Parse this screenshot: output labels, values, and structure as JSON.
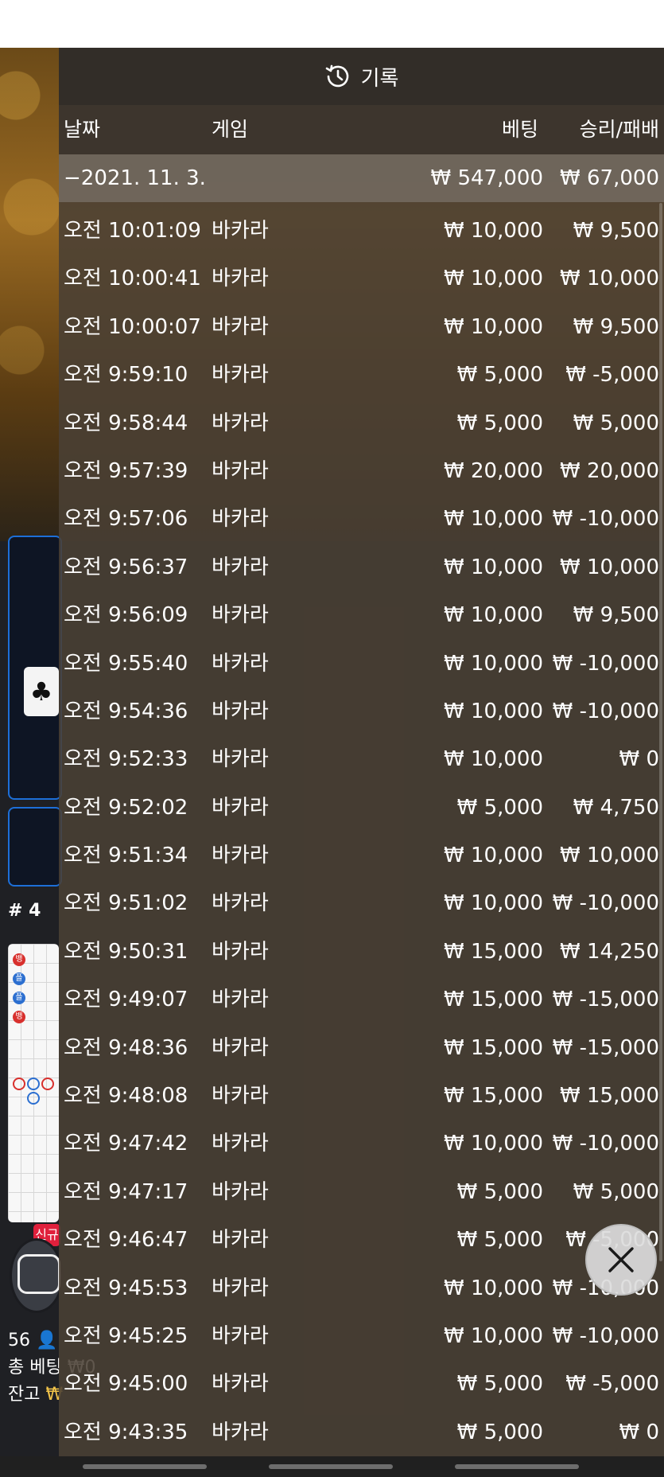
{
  "header": {
    "title": "기록",
    "icon": "history-icon"
  },
  "columns": {
    "date": "날짜",
    "game": "게임",
    "bet": "베팅",
    "winloss": "승리/패배"
  },
  "summary": {
    "date": "−2021. 11. 3.",
    "bet": "₩ 547,000",
    "winloss": "₩ 67,000"
  },
  "rows": [
    {
      "time": "오전 10:01:09",
      "game": "바카라",
      "bet": "₩ 10,000",
      "winloss": "₩ 9,500"
    },
    {
      "time": "오전 10:00:41",
      "game": "바카라",
      "bet": "₩ 10,000",
      "winloss": "₩ 10,000"
    },
    {
      "time": "오전 10:00:07",
      "game": "바카라",
      "bet": "₩ 10,000",
      "winloss": "₩ 9,500"
    },
    {
      "time": "오전 9:59:10",
      "game": "바카라",
      "bet": "₩ 5,000",
      "winloss": "₩ -5,000"
    },
    {
      "time": "오전 9:58:44",
      "game": "바카라",
      "bet": "₩ 5,000",
      "winloss": "₩ 5,000"
    },
    {
      "time": "오전 9:57:39",
      "game": "바카라",
      "bet": "₩ 20,000",
      "winloss": "₩ 20,000"
    },
    {
      "time": "오전 9:57:06",
      "game": "바카라",
      "bet": "₩ 10,000",
      "winloss": "₩ -10,000"
    },
    {
      "time": "오전 9:56:37",
      "game": "바카라",
      "bet": "₩ 10,000",
      "winloss": "₩ 10,000"
    },
    {
      "time": "오전 9:56:09",
      "game": "바카라",
      "bet": "₩ 10,000",
      "winloss": "₩ 9,500"
    },
    {
      "time": "오전 9:55:40",
      "game": "바카라",
      "bet": "₩ 10,000",
      "winloss": "₩ -10,000"
    },
    {
      "time": "오전 9:54:36",
      "game": "바카라",
      "bet": "₩ 10,000",
      "winloss": "₩ -10,000"
    },
    {
      "time": "오전 9:52:33",
      "game": "바카라",
      "bet": "₩ 10,000",
      "winloss": "₩ 0"
    },
    {
      "time": "오전 9:52:02",
      "game": "바카라",
      "bet": "₩ 5,000",
      "winloss": "₩ 4,750"
    },
    {
      "time": "오전 9:51:34",
      "game": "바카라",
      "bet": "₩ 10,000",
      "winloss": "₩ 10,000"
    },
    {
      "time": "오전 9:51:02",
      "game": "바카라",
      "bet": "₩ 10,000",
      "winloss": "₩ -10,000"
    },
    {
      "time": "오전 9:50:31",
      "game": "바카라",
      "bet": "₩ 15,000",
      "winloss": "₩ 14,250"
    },
    {
      "time": "오전 9:49:07",
      "game": "바카라",
      "bet": "₩ 15,000",
      "winloss": "₩ -15,000"
    },
    {
      "time": "오전 9:48:36",
      "game": "바카라",
      "bet": "₩ 15,000",
      "winloss": "₩ -15,000"
    },
    {
      "time": "오전 9:48:08",
      "game": "바카라",
      "bet": "₩ 15,000",
      "winloss": "₩ 15,000"
    },
    {
      "time": "오전 9:47:42",
      "game": "바카라",
      "bet": "₩ 10,000",
      "winloss": "₩ -10,000"
    },
    {
      "time": "오전 9:47:17",
      "game": "바카라",
      "bet": "₩ 5,000",
      "winloss": "₩ 5,000"
    },
    {
      "time": "오전 9:46:47",
      "game": "바카라",
      "bet": "₩ 5,000",
      "winloss": "₩ -5,000"
    },
    {
      "time": "오전 9:45:53",
      "game": "바카라",
      "bet": "₩ 10,000",
      "winloss": "₩ -10,000"
    },
    {
      "time": "오전 9:45:25",
      "game": "바카라",
      "bet": "₩ 10,000",
      "winloss": "₩ -10,000"
    },
    {
      "time": "오전 9:45:00",
      "game": "바카라",
      "bet": "₩ 5,000",
      "winloss": "₩ -5,000"
    },
    {
      "time": "오전 9:43:35",
      "game": "바카라",
      "bet": "₩ 5,000",
      "winloss": "₩ 0"
    }
  ],
  "background": {
    "table_number": "# 4",
    "new_badge": "신규",
    "player_count": "56",
    "total_bet_label": "총 베팅",
    "total_bet_value": "₩0",
    "balance_label": "잔고",
    "balance_value": "₩"
  },
  "close_button": {
    "icon": "close-icon"
  },
  "colors": {
    "panel": "#4a4034",
    "header": "#302c28",
    "accent_blue": "#1d6fd8",
    "gold": "#f2c44a"
  }
}
